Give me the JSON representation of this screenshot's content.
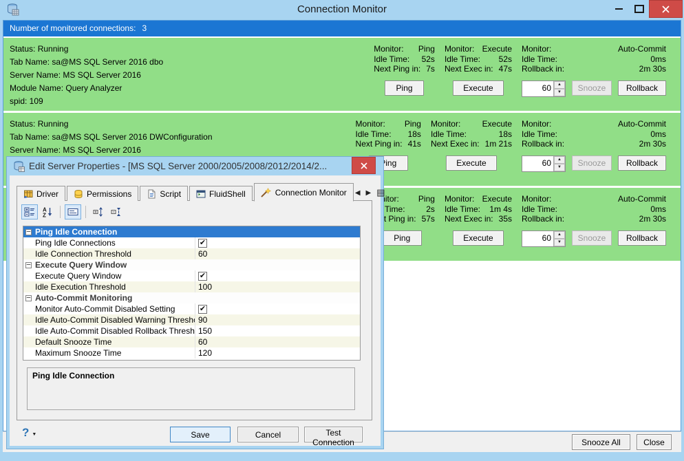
{
  "colors": {
    "titlebar_blue": "#a8d4f1",
    "header_blue": "#1b76d3",
    "panel_green": "#91de87",
    "selected_row_blue": "#2e7bd0",
    "close_red": "#cf4b47"
  },
  "glyphs": {
    "check": "✔",
    "up": "▲",
    "down": "▼",
    "prev": "◀",
    "next": "▶",
    "list_view": "▤",
    "minus": "–",
    "caret_down": "▼"
  },
  "window": {
    "title": "Connection Monitor"
  },
  "header": {
    "label": "Number of monitored connections:",
    "count": "3"
  },
  "monitor_labels": {
    "monitor": "Monitor:",
    "idle_time": "Idle Time:",
    "next_ping": "Next Ping in:",
    "next_exec": "Next Exec in:",
    "rollback_in": "Rollback in:",
    "ping_type": "Ping",
    "execute_type": "Execute",
    "autocommit_type": "Auto-Commit",
    "ping_button": "Ping",
    "execute_button": "Execute",
    "snooze_button": "Snooze",
    "rollback_button": "Rollback"
  },
  "connections": [
    {
      "info": [
        "Status: Running",
        "Tab Name: sa@MS SQL Server 2016 dbo",
        "Server Name: MS SQL Server 2016",
        "Module Name: Query Analyzer",
        "spid: 109"
      ],
      "ping": {
        "idle": "52s",
        "next": "7s"
      },
      "execute": {
        "idle": "52s",
        "next": "47s"
      },
      "autocommit": {
        "idle": "0ms",
        "rollback": "2m 30s"
      },
      "snooze_value": "60"
    },
    {
      "info": [
        "Status: Running",
        "Tab Name: sa@MS SQL Server 2016 DWConfiguration",
        "Server Name: MS SQL Server 2016"
      ],
      "ping": {
        "idle": "18s",
        "next": "41s"
      },
      "execute": {
        "idle": "18s",
        "next": "1m 21s"
      },
      "autocommit": {
        "idle": "0ms",
        "rollback": "2m 30s"
      },
      "snooze_value": "60"
    },
    {
      "info": [],
      "ping": {
        "idle": "2s",
        "next": "57s"
      },
      "execute": {
        "idle": "1m 4s",
        "next": "35s"
      },
      "autocommit": {
        "idle": "0ms",
        "rollback": "2m 30s"
      },
      "snooze_value": "60"
    }
  ],
  "footer": {
    "snooze_all": "Snooze All",
    "close": "Close"
  },
  "dialog": {
    "title": "Edit Server Properties - [MS SQL Server 2000/2005/2008/2012/2014/2...",
    "tabs": [
      {
        "label": "Driver",
        "icon": "driver-table-icon",
        "active": false
      },
      {
        "label": "Permissions",
        "icon": "permissions-icon",
        "active": false
      },
      {
        "label": "Script",
        "icon": "script-icon",
        "active": false
      },
      {
        "label": "FluidShell",
        "icon": "fluidshell-icon",
        "active": false
      },
      {
        "label": "Connection Monitor",
        "icon": "connection-monitor-icon",
        "active": true
      }
    ],
    "toolbar": [
      {
        "icon": "categorized-view-icon",
        "selected": true
      },
      {
        "icon": "alphabetical-sort-icon",
        "selected": false
      },
      {
        "icon": "property-description-icon",
        "selected": true
      },
      {
        "icon": "expand-sections-icon",
        "selected": false
      },
      {
        "icon": "collapse-sections-icon",
        "selected": false
      }
    ],
    "grid": {
      "groups": [
        {
          "label": "Ping Idle Connection",
          "selected": true,
          "rows": [
            {
              "name": "Ping Idle Connections",
              "checked": true
            },
            {
              "name": "Idle Connection Threshold",
              "value": "60"
            }
          ]
        },
        {
          "label": "Execute Query Window",
          "selected": false,
          "rows": [
            {
              "name": "Execute Query Window",
              "checked": true
            },
            {
              "name": "Idle Execution Threshold",
              "value": "100"
            }
          ]
        },
        {
          "label": "Auto-Commit Monitoring",
          "selected": false,
          "rows": [
            {
              "name": "Monitor Auto-Commit Disabled Setting",
              "checked": true
            },
            {
              "name": "Idle Auto-Commit Disabled Warning Threshold",
              "value": "90"
            },
            {
              "name": "Idle Auto-Commit Disabled Rollback Threshold",
              "value": "150"
            },
            {
              "name": "Default Snooze Time",
              "value": "60"
            },
            {
              "name": "Maximum Snooze Time",
              "value": "120"
            }
          ]
        }
      ]
    },
    "description_title": "Ping Idle Connection",
    "help": "?",
    "buttons": {
      "save": "Save",
      "cancel": "Cancel",
      "test": "Test Connection"
    }
  }
}
